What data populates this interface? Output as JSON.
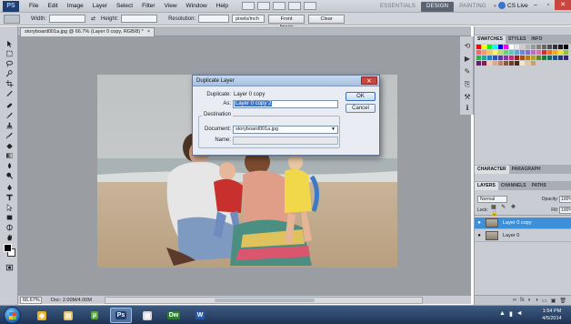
{
  "app": {
    "logo": "PS",
    "menu": [
      "File",
      "Edit",
      "Image",
      "Layer",
      "Select",
      "Filter",
      "View",
      "Window",
      "Help"
    ],
    "workspaces": [
      "ESSENTIALS",
      "DESIGN",
      "PAINTING"
    ],
    "active_workspace": "DESIGN",
    "workspace_more": "»",
    "cs_live": "CS Live",
    "window_controls": {
      "minimize": "–",
      "restore": "▫",
      "close": "✕"
    }
  },
  "options_bar": {
    "width_label": "Width:",
    "swap": "⇄",
    "height_label": "Height:",
    "resolution_label": "Resolution:",
    "unit": "pixels/inch",
    "front_image_button": "Front Image",
    "clear_button": "Clear"
  },
  "document": {
    "tab_label": "storyboard001a.jpg @ 66.7% (Layer 0 copy, RGB/8) *",
    "tab_close": "×"
  },
  "status_bar": {
    "zoom": "66.67%",
    "doc_info": "Doc: 2.00M/4.00M"
  },
  "panels": {
    "top_tabs": [
      "SWATCHES",
      "STYLES",
      "INFO"
    ],
    "mid_tabs": [
      "CHARACTER",
      "PARAGRAPH"
    ],
    "layers_tabs": [
      "LAYERS",
      "CHANNELS",
      "PATHS"
    ],
    "blend_mode": "Normal",
    "opacity_label": "Opacity:",
    "opacity_value": "100%",
    "lock_label": "Lock:",
    "lock_icons": "▦ ✎ ✥ 🔒",
    "fill_label": "Fill:",
    "fill_value": "100%",
    "layers": [
      {
        "name": "Layer 0 copy",
        "selected": true
      },
      {
        "name": "Layer 0",
        "selected": false
      }
    ],
    "footer_icons": [
      "∞",
      "fx",
      "◐",
      "◑",
      "▭",
      "▣",
      "🗑"
    ],
    "swatch_colors": [
      "#ff0000",
      "#ffff00",
      "#00ff00",
      "#00ffff",
      "#0000ff",
      "#ff00ff",
      "#ffffff",
      "#e6e6e6",
      "#cccccc",
      "#b3b3b3",
      "#999999",
      "#808080",
      "#666666",
      "#4d4d4d",
      "#333333",
      "#1a1a1a",
      "#000000",
      "#ef6b6b",
      "#f59a5f",
      "#fdc35c",
      "#fff466",
      "#b7e06a",
      "#6fcf7a",
      "#5ec7b5",
      "#5aa6e0",
      "#6a85d4",
      "#8a6ec9",
      "#b86fc6",
      "#e06fa3",
      "#d62d2d",
      "#e8761e",
      "#f6a81d",
      "#f2e12c",
      "#8dc63f",
      "#2db34a",
      "#1aa99a",
      "#1c7fcc",
      "#2e55b3",
      "#5b37a8",
      "#8e33a6",
      "#c72b7a",
      "#9e1b1b",
      "#a8500f",
      "#b67a0e",
      "#b1a31a",
      "#5e8b25",
      "#1b7a33",
      "#127065",
      "#14578c",
      "#1f3a7a",
      "#3d2573",
      "#611f71",
      "#891c53",
      "#f2c9b3",
      "#d9a98b",
      "#b88463",
      "#8c5a3c",
      "#6b4026",
      "#4a2a18",
      "#f6e7c8",
      "#e0c89a",
      "#c4a46b"
    ]
  },
  "dialog": {
    "title": "Duplicate Layer",
    "close": "✕",
    "duplicate_label": "Duplicate:",
    "duplicate_value": "Layer 0 copy",
    "as_label": "As:",
    "as_value": "Layer 0 copy 2",
    "destination_label": "Destination",
    "document_label": "Document:",
    "document_value": "storyboard001a.jpg",
    "name_label": "Name:",
    "ok_button": "OK",
    "cancel_button": "Cancel"
  },
  "taskbar": {
    "apps": [
      {
        "icon": "chrome-icon",
        "glyph": "◉",
        "color": "#e8b32b"
      },
      {
        "icon": "folder-icon",
        "glyph": "▤",
        "color": "#e2c26a"
      },
      {
        "icon": "utorrent-icon",
        "glyph": "μ",
        "color": "#57a83a"
      },
      {
        "icon": "photoshop-icon",
        "glyph": "Ps",
        "color": "#1f3d6e"
      },
      {
        "icon": "document-icon",
        "glyph": "▥",
        "color": "#d8d8d8"
      },
      {
        "icon": "dreamweaver-icon",
        "glyph": "Dw",
        "color": "#2e7d32"
      },
      {
        "icon": "word-icon",
        "glyph": "W",
        "color": "#2a57a8"
      }
    ],
    "time": "1:54 PM",
    "date": "4/5/2014"
  }
}
